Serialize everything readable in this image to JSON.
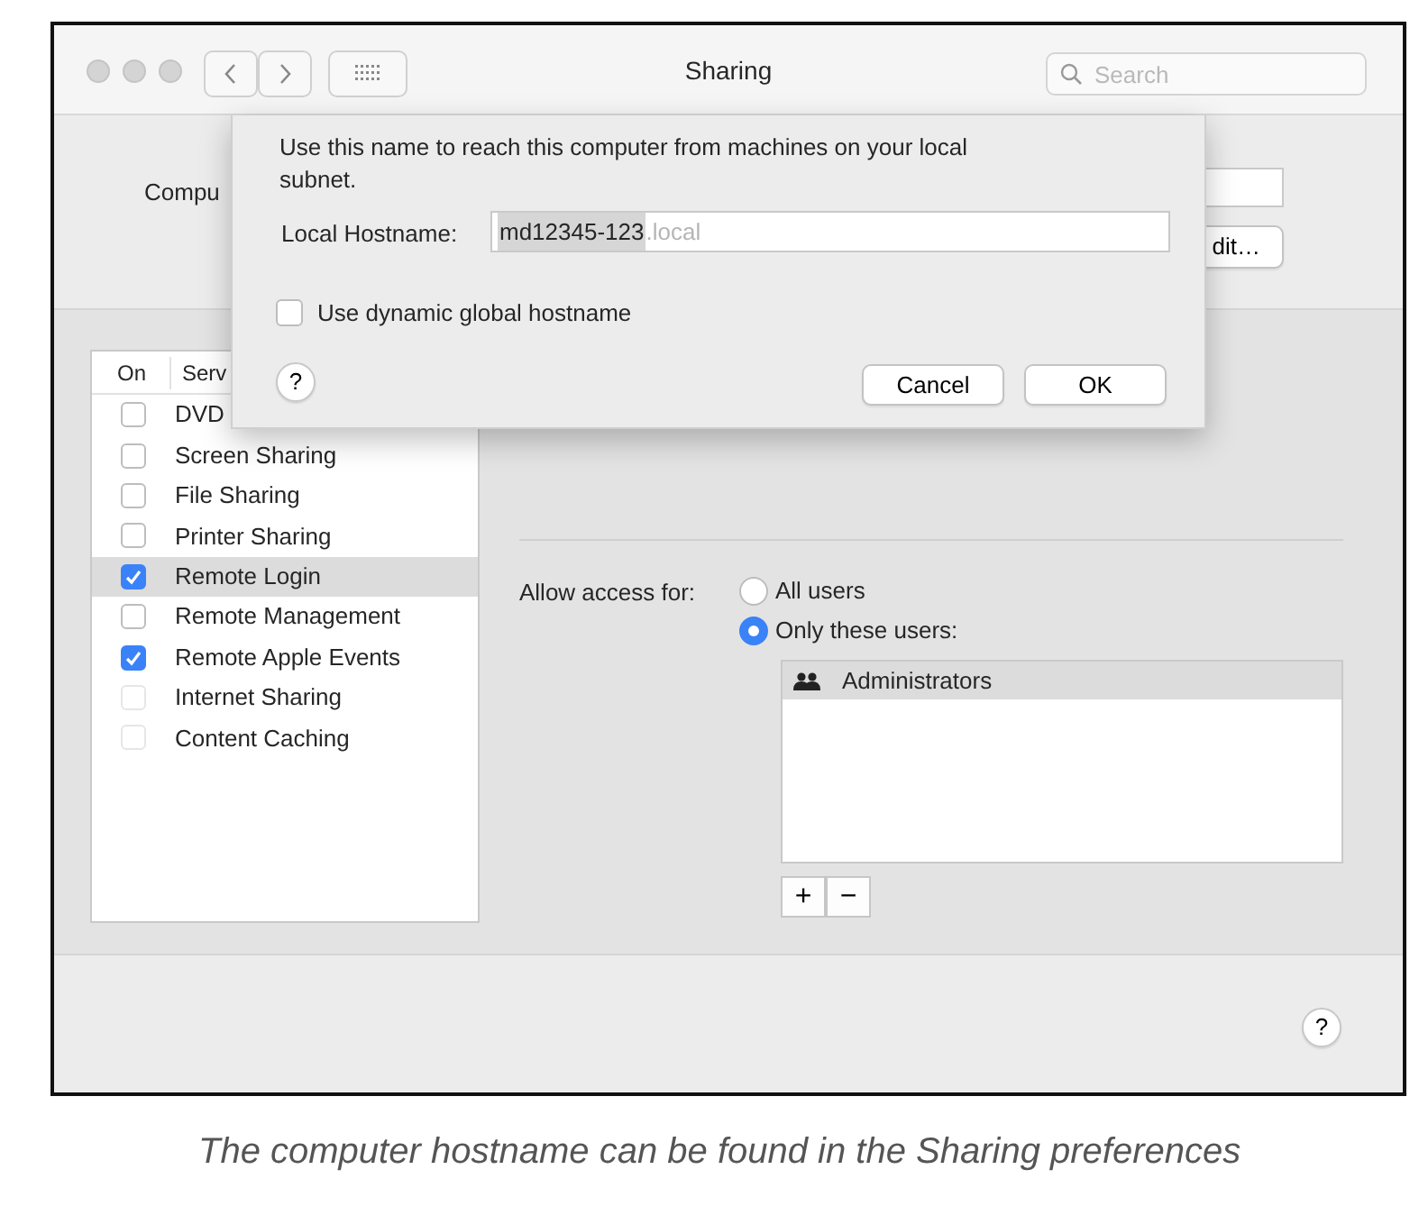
{
  "window": {
    "title": "Sharing",
    "search": {
      "placeholder": "Search"
    }
  },
  "computer_name": {
    "label": "Compu",
    "button": "dit…"
  },
  "services": {
    "columns": [
      "On",
      "Serv"
    ],
    "items": [
      {
        "name": "DVD",
        "checked": false,
        "selected": false,
        "disabled": false
      },
      {
        "name": "Screen Sharing",
        "checked": false,
        "selected": false,
        "disabled": false
      },
      {
        "name": "File Sharing",
        "checked": false,
        "selected": false,
        "disabled": false
      },
      {
        "name": "Printer Sharing",
        "checked": false,
        "selected": false,
        "disabled": false
      },
      {
        "name": "Remote Login",
        "checked": true,
        "selected": true,
        "disabled": false
      },
      {
        "name": "Remote Management",
        "checked": false,
        "selected": false,
        "disabled": false
      },
      {
        "name": "Remote Apple Events",
        "checked": true,
        "selected": false,
        "disabled": false
      },
      {
        "name": "Internet Sharing",
        "checked": false,
        "selected": false,
        "disabled": true
      },
      {
        "name": "Content Caching",
        "checked": false,
        "selected": false,
        "disabled": true
      }
    ]
  },
  "access": {
    "label": "Allow access for:",
    "options": [
      {
        "label": "All users",
        "selected": false
      },
      {
        "label": "Only these users:",
        "selected": true
      }
    ],
    "users": [
      {
        "name": "Administrators",
        "selected": true
      }
    ],
    "add": "+",
    "remove": "−"
  },
  "help": "?",
  "dialog": {
    "message": "Use this name to reach this computer from machines on your local subnet.",
    "hostname_label": "Local Hostname:",
    "hostname_value": "md12345-123",
    "hostname_suffix": ".local",
    "value_selected": true,
    "dynamic_checkbox": {
      "label": "Use dynamic global hostname",
      "checked": false
    },
    "help": "?",
    "buttons": [
      "Cancel",
      "OK"
    ]
  },
  "caption": "The computer hostname can be found in the Sharing preferences"
}
